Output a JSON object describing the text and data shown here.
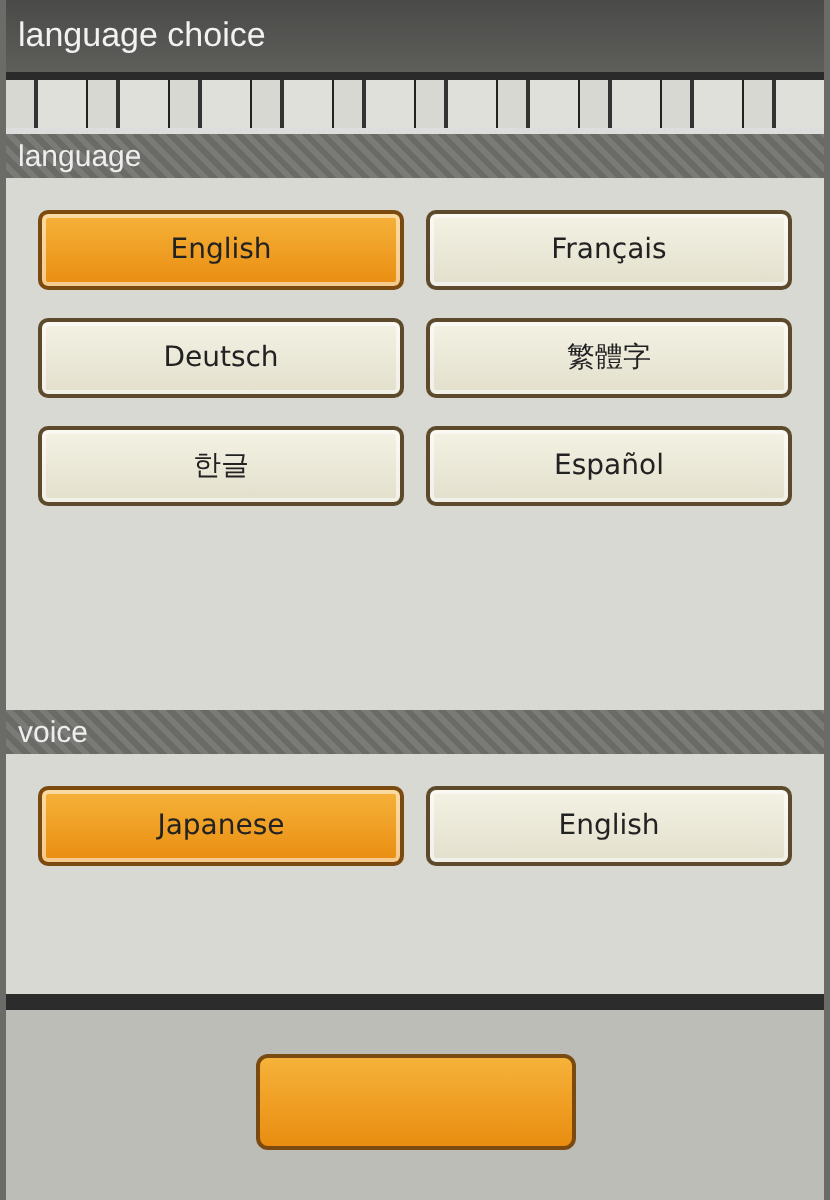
{
  "window": {
    "title": "language choice"
  },
  "sections": [
    {
      "title": "language",
      "options": [
        {
          "label": "English",
          "selected": true
        },
        {
          "label": "Français",
          "selected": false
        },
        {
          "label": "Deutsch",
          "selected": false
        },
        {
          "label": "繁體字",
          "selected": false
        },
        {
          "label": "한글",
          "selected": false
        },
        {
          "label": "Español",
          "selected": false
        }
      ]
    },
    {
      "title": "voice",
      "options": [
        {
          "label": "Japanese",
          "selected": true
        },
        {
          "label": "English",
          "selected": false
        }
      ]
    }
  ]
}
